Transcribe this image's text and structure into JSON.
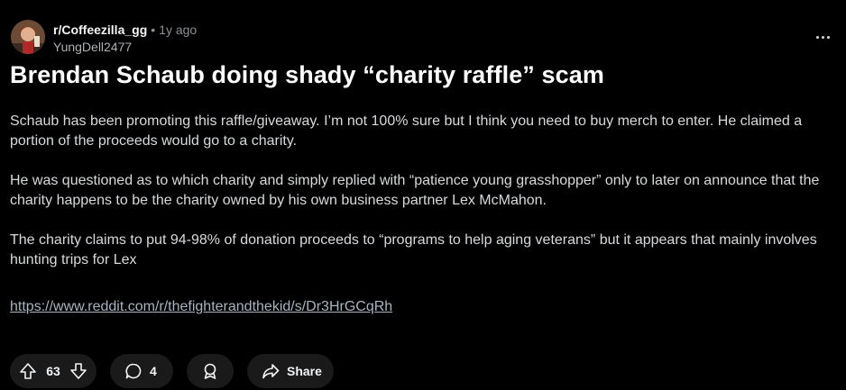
{
  "post": {
    "subreddit": "r/Coffeezilla_gg",
    "separator": "•",
    "time": "1y ago",
    "author": "YungDell2477",
    "title": "Brendan Schaub doing shady “charity raffle” scam",
    "paragraphs": [
      "Schaub has been promoting this raffle/giveaway. I’m not 100% sure but I think you need to buy merch to enter. He claimed a portion of the proceeds would go to a charity.",
      "He was questioned as to which charity and simply replied with “patience young grasshopper” only to later on announce that the charity happens to be the charity owned by his own business partner Lex McMahon.",
      "The charity claims to put 94-98% of donation proceeds to “programs to help aging veterans” but it appears that mainly involves hunting trips for Lex"
    ],
    "link": "https://www.reddit.com/r/thefighterandthekid/s/Dr3HrGCqRh"
  },
  "actions": {
    "score": "63",
    "comments": "4",
    "share_label": "Share"
  },
  "icons": {
    "upvote": "arrow-up-icon",
    "downvote": "arrow-down-icon",
    "comment": "speech-bubble-icon",
    "award": "award-ribbon-icon",
    "share": "share-arrow-icon",
    "more": "ellipsis-icon"
  }
}
